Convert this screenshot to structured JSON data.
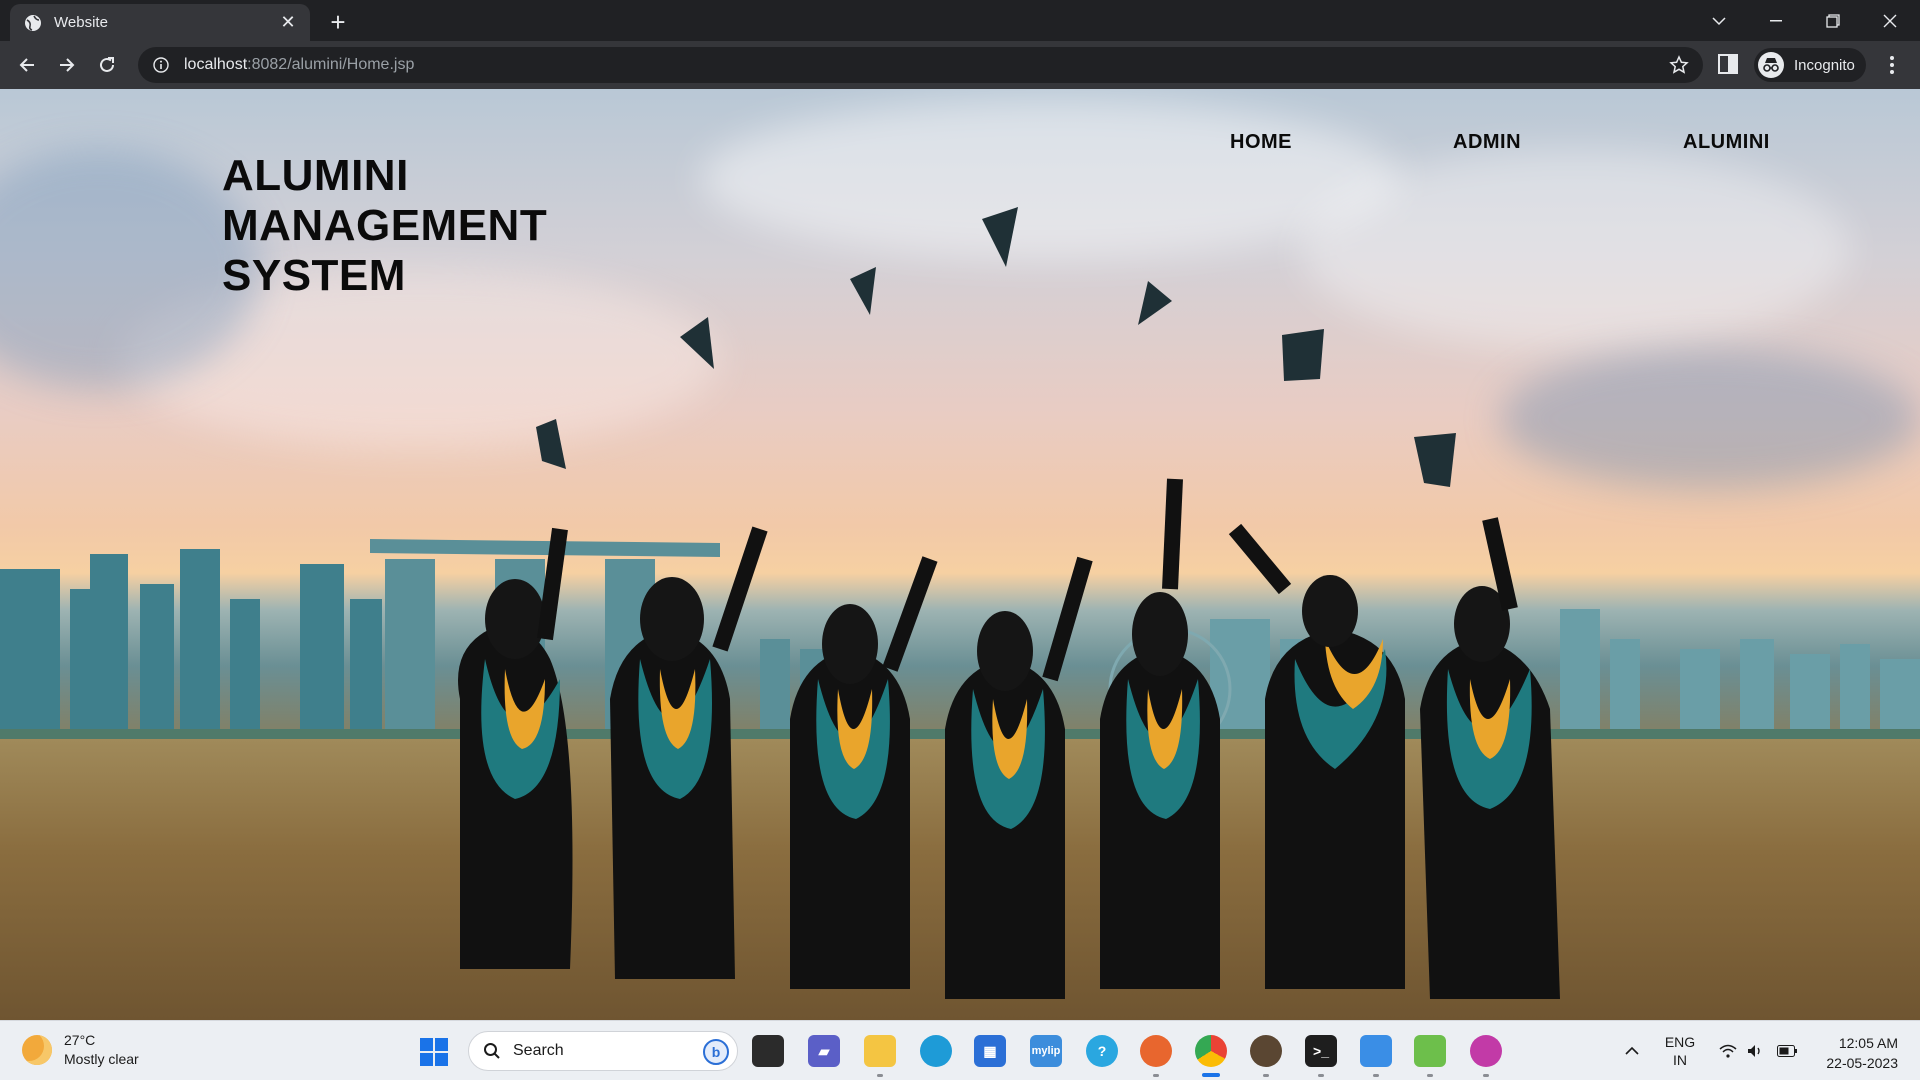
{
  "browser": {
    "tab_title": "Website",
    "url_host": "localhost",
    "url_path": ":8082/alumini/Home.jsp",
    "profile_label": "Incognito",
    "icons": [
      "globe-icon",
      "close-icon",
      "plus-icon",
      "back-icon",
      "forward-icon",
      "reload-icon",
      "info-icon",
      "star-icon",
      "side-panel-icon",
      "incognito-icon",
      "more-icon"
    ]
  },
  "site": {
    "title_lines": [
      "ALUMINI",
      "MANAGEMENT",
      "SYSTEM"
    ],
    "nav": {
      "home": "HOME",
      "admin": "ADMIN",
      "alumini": "ALUMINI"
    },
    "title_color": "#0b0b0b"
  },
  "taskbar": {
    "weather_temp": "27°C",
    "weather_desc": "Mostly clear",
    "search_placeholder": "Search",
    "language_top": "ENG",
    "language_bottom": "IN",
    "time": "12:05 AM",
    "date": "22-05-2023"
  }
}
